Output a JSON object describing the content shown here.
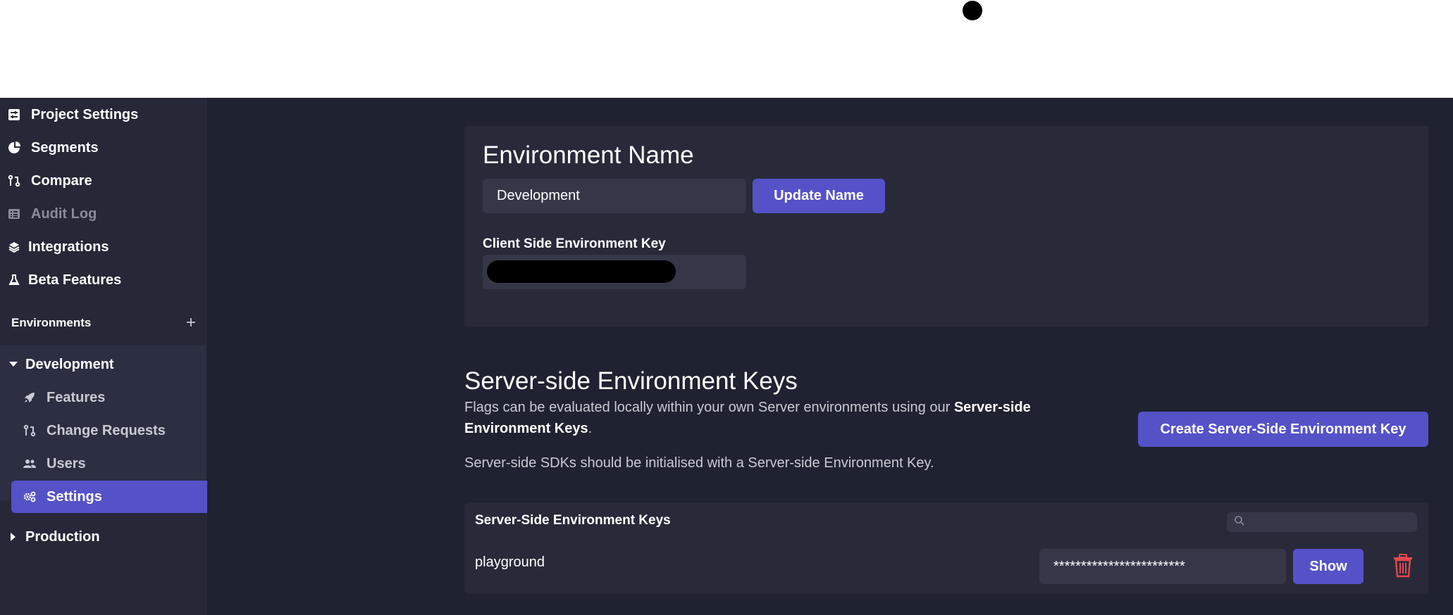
{
  "sidebar": {
    "items": [
      {
        "label": "Project Settings",
        "icon": "sliders-icon"
      },
      {
        "label": "Segments",
        "icon": "pie-chart-icon"
      },
      {
        "label": "Compare",
        "icon": "git-compare-icon"
      },
      {
        "label": "Audit Log",
        "icon": "list-icon"
      },
      {
        "label": "Integrations",
        "icon": "layers-icon"
      },
      {
        "label": "Beta Features",
        "icon": "flask-icon"
      }
    ],
    "environments_label": "Environments",
    "add_symbol": "+",
    "development": {
      "label": "Development",
      "children": [
        {
          "label": "Features",
          "icon": "rocket-icon"
        },
        {
          "label": "Change Requests",
          "icon": "git-pull-icon"
        },
        {
          "label": "Users",
          "icon": "users-icon"
        },
        {
          "label": "Settings",
          "icon": "gears-icon"
        }
      ]
    },
    "production": {
      "label": "Production"
    }
  },
  "env_card": {
    "title": "Environment Name",
    "name_value": "Development",
    "update_button": "Update Name",
    "client_key_label": "Client Side Environment Key"
  },
  "server_keys": {
    "title": "Server-side Environment Keys",
    "para1_prefix": "Flags can be evaluated locally within your own Server environments using our ",
    "para1_bold": "Server-side Environment Keys",
    "para1_suffix": ".",
    "para2": "Server-side SDKs should be initialised with a Server-side Environment Key.",
    "create_button": "Create Server-Side Environment Key",
    "table_title": "Server-Side Environment Keys",
    "rows": [
      {
        "name": "playground",
        "masked_key": "************************",
        "show_button": "Show"
      }
    ]
  },
  "colors": {
    "accent": "#5552c8",
    "background": "#1f2230",
    "card": "#282a3a",
    "danger": "#e5484d"
  }
}
